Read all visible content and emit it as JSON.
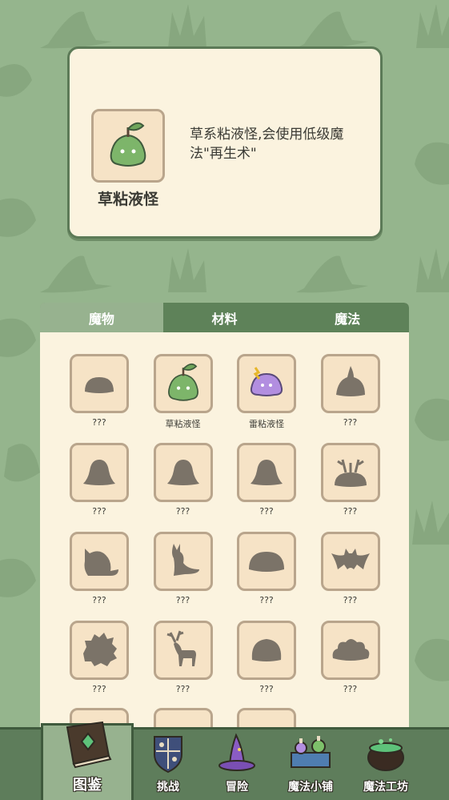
{
  "colors": {
    "background": "#95b58d",
    "card": "#fbf3df",
    "tab_active": "#97b28f",
    "tab_inactive": "#5e8259",
    "slot": "#f6e3c6",
    "silhouette": "#7b7368",
    "slime_green": "#7db56a",
    "slime_purple": "#b28ee0"
  },
  "detail": {
    "name": "草粘液怪",
    "description": "草系粘液怪,会使用低级魔法\"再生术\"",
    "icon": "grass-slime-icon"
  },
  "tabs": [
    {
      "label": "魔物",
      "active": true
    },
    {
      "label": "材料",
      "active": false
    },
    {
      "label": "魔法",
      "active": false
    }
  ],
  "monsters": [
    {
      "label": "???",
      "icon": "blob-silhouette-icon",
      "known": false
    },
    {
      "label": "草粘液怪",
      "icon": "grass-slime-icon",
      "known": true
    },
    {
      "label": "雷粘液怪",
      "icon": "thunder-slime-icon",
      "known": true
    },
    {
      "label": "???",
      "icon": "flame-slime-silhouette-icon",
      "known": false
    },
    {
      "label": "???",
      "icon": "bell-slime-silhouette-icon",
      "known": false
    },
    {
      "label": "???",
      "icon": "bell-slime-silhouette-icon",
      "known": false
    },
    {
      "label": "???",
      "icon": "bell-slime-silhouette-icon",
      "known": false
    },
    {
      "label": "???",
      "icon": "antler-bush-silhouette-icon",
      "known": false
    },
    {
      "label": "???",
      "icon": "beast-silhouette-icon",
      "known": false
    },
    {
      "label": "???",
      "icon": "kangaroo-silhouette-icon",
      "known": false
    },
    {
      "label": "???",
      "icon": "shell-silhouette-icon",
      "known": false
    },
    {
      "label": "???",
      "icon": "bat-silhouette-icon",
      "known": false
    },
    {
      "label": "???",
      "icon": "hedgehog-silhouette-icon",
      "known": false
    },
    {
      "label": "???",
      "icon": "deer-silhouette-icon",
      "known": false
    },
    {
      "label": "???",
      "icon": "dome-silhouette-icon",
      "known": false
    },
    {
      "label": "???",
      "icon": "cloud-silhouette-icon",
      "known": false
    }
  ],
  "nav": [
    {
      "label": "图鉴",
      "icon": "book-icon",
      "active": true
    },
    {
      "label": "挑战",
      "icon": "shield-icon",
      "active": false
    },
    {
      "label": "冒险",
      "icon": "wizard-hat-icon",
      "active": false
    },
    {
      "label": "魔法小铺",
      "icon": "potion-shop-icon",
      "active": false
    },
    {
      "label": "魔法工坊",
      "icon": "cauldron-icon",
      "active": false
    }
  ]
}
